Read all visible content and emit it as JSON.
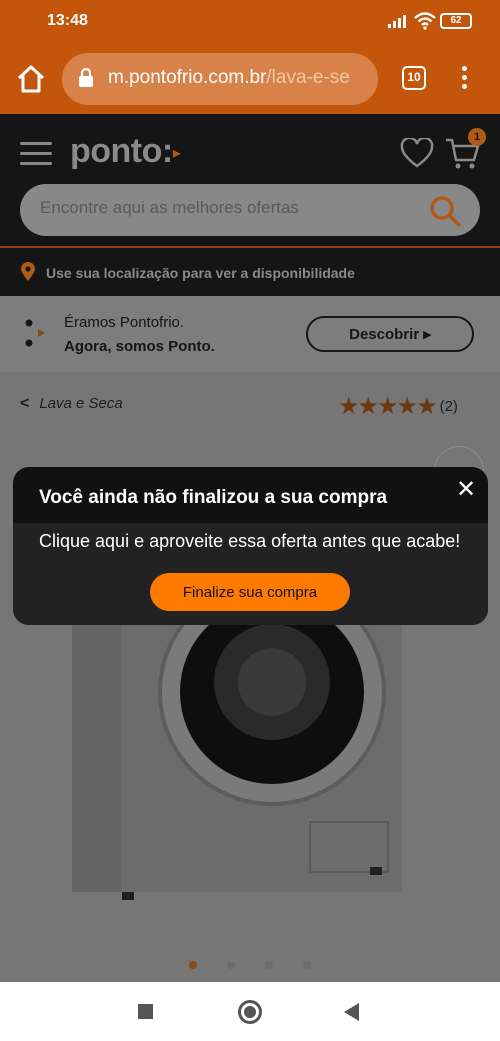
{
  "status_bar": {
    "time": "13:48",
    "battery": "62"
  },
  "browser": {
    "url_host": "m.pontofrio.com.br",
    "url_path": "/lava-e-se",
    "tab_count": "10"
  },
  "header": {
    "logo": "ponto:",
    "cart_count": "1",
    "search_placeholder": "Encontre aqui as melhores ofertas"
  },
  "location_bar": {
    "text": "Use sua localização para ver a disponibilidade"
  },
  "info_banner": {
    "line1": "Éramos Pontofrio.",
    "line2": "Agora, somos Ponto.",
    "button_label": "Descobrir ▸"
  },
  "product": {
    "breadcrumb": "Lava e Seca",
    "rating_stars": "★★★★★",
    "rating_value": 5,
    "review_count": "(2)",
    "carousel_total": 4,
    "carousel_active": 1
  },
  "modal": {
    "title": "Você ainda não finalizou a sua compra",
    "close": "✕",
    "message": "Clique aqui e aproveite essa oferta antes que acabe!",
    "cta_label": "Finalize sua compra"
  },
  "colors": {
    "chrome_orange": "#c4560c",
    "accent_orange": "#ff7a00",
    "header_dark": "#151515"
  }
}
